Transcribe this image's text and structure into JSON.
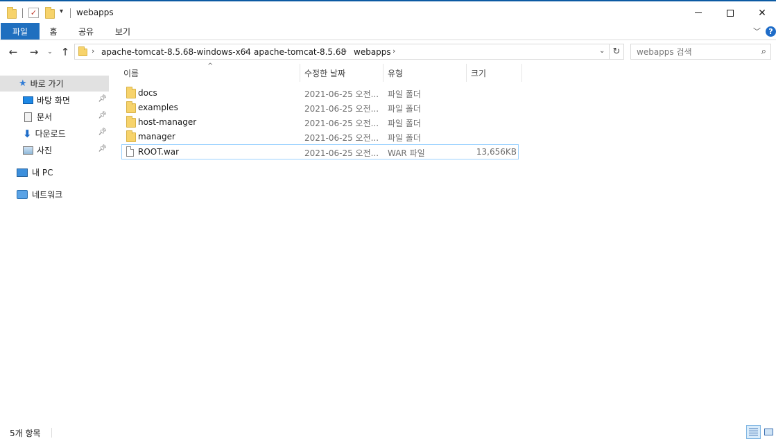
{
  "window": {
    "title": "webapps",
    "minimize_icon": "minimize-icon",
    "maximize_icon": "maximize-icon",
    "close_icon": "close-icon"
  },
  "ribbon": {
    "tabs": [
      "파일",
      "홈",
      "공유",
      "보기"
    ]
  },
  "address": {
    "crumbs": [
      "apache-tomcat-8.5.68-windows-x64",
      "apache-tomcat-8.5.68",
      "webapps"
    ]
  },
  "search": {
    "placeholder": "webapps 검색"
  },
  "nav": {
    "quick_access": "바로 가기",
    "items": [
      "바탕 화면",
      "문서",
      "다운로드",
      "사진"
    ],
    "this_pc": "내 PC",
    "network": "네트워크"
  },
  "columns": {
    "name": "이름",
    "modified": "수정한 날짜",
    "type": "유형",
    "size": "크기"
  },
  "files": [
    {
      "name": "docs",
      "modified": "2021-06-25 오전...",
      "type": "파일 폴더",
      "size": "",
      "kind": "folder"
    },
    {
      "name": "examples",
      "modified": "2021-06-25 오전...",
      "type": "파일 폴더",
      "size": "",
      "kind": "folder"
    },
    {
      "name": "host-manager",
      "modified": "2021-06-25 오전...",
      "type": "파일 폴더",
      "size": "",
      "kind": "folder"
    },
    {
      "name": "manager",
      "modified": "2021-06-25 오전...",
      "type": "파일 폴더",
      "size": "",
      "kind": "folder"
    },
    {
      "name": "ROOT.war",
      "modified": "2021-06-25 오전...",
      "type": "WAR 파일",
      "size": "13,656KB",
      "kind": "file"
    }
  ],
  "status": {
    "count": "5개 항목"
  },
  "colors": {
    "accent": "#1f6fbf",
    "folder": "#f7d36b",
    "selection": "#e1e1e1",
    "focus": "#99d1ff"
  }
}
